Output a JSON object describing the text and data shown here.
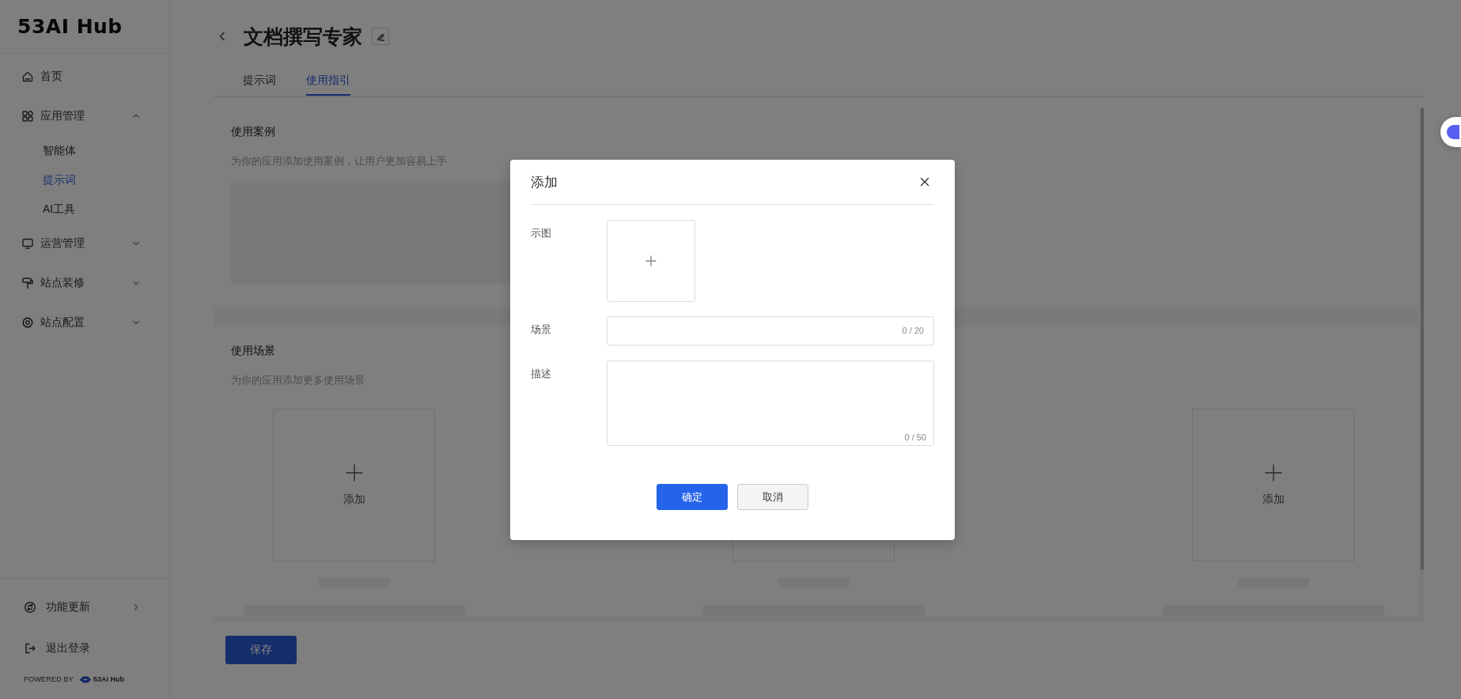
{
  "sidebar": {
    "logo": "53AI Hub",
    "items": [
      {
        "kind": "link",
        "label": "首页"
      },
      {
        "kind": "group",
        "label": "应用管理",
        "expanded": true,
        "children": [
          {
            "label": "智能体",
            "selected": false
          },
          {
            "label": "提示词",
            "selected": true
          },
          {
            "label": "AI工具",
            "selected": false
          }
        ]
      },
      {
        "kind": "group",
        "label": "运营管理",
        "expanded": false
      },
      {
        "kind": "group",
        "label": "站点装修",
        "expanded": false
      },
      {
        "kind": "group",
        "label": "站点配置",
        "expanded": false
      }
    ],
    "bottom_items": [
      {
        "label": "功能更新",
        "kind": "more"
      },
      {
        "label": "退出登录",
        "kind": "link"
      }
    ],
    "powered_by": {
      "text": "POWERED BY",
      "brand": "53AI Hub"
    }
  },
  "page": {
    "title": "文档撰写专家",
    "tabs": [
      {
        "label": "提示词",
        "selected": false
      },
      {
        "label": "使用指引",
        "selected": true
      }
    ],
    "sections": [
      {
        "kind": "cases",
        "title": "使用案例",
        "description": "为你的应用添加使用案例，让用户更加容易上手"
      },
      {
        "kind": "scenarios",
        "title": "使用场景",
        "description": "为你的应用添加更多使用场景",
        "cards": [
          {
            "kind": "add",
            "label": "添加"
          },
          {
            "kind": "covered"
          },
          {
            "kind": "add",
            "label": "添加"
          }
        ]
      }
    ],
    "save_button": "保存"
  },
  "dialog": {
    "title": "添加",
    "fields": [
      {
        "kind": "upload",
        "label": "示图"
      },
      {
        "kind": "input",
        "label": "场景",
        "counter": "0 / 20"
      },
      {
        "kind": "textarea",
        "label": "描述",
        "counter": "0 / 50"
      }
    ],
    "buttons": [
      {
        "kind": "primary",
        "label": "确定"
      },
      {
        "kind": "default",
        "label": "取消"
      }
    ]
  }
}
